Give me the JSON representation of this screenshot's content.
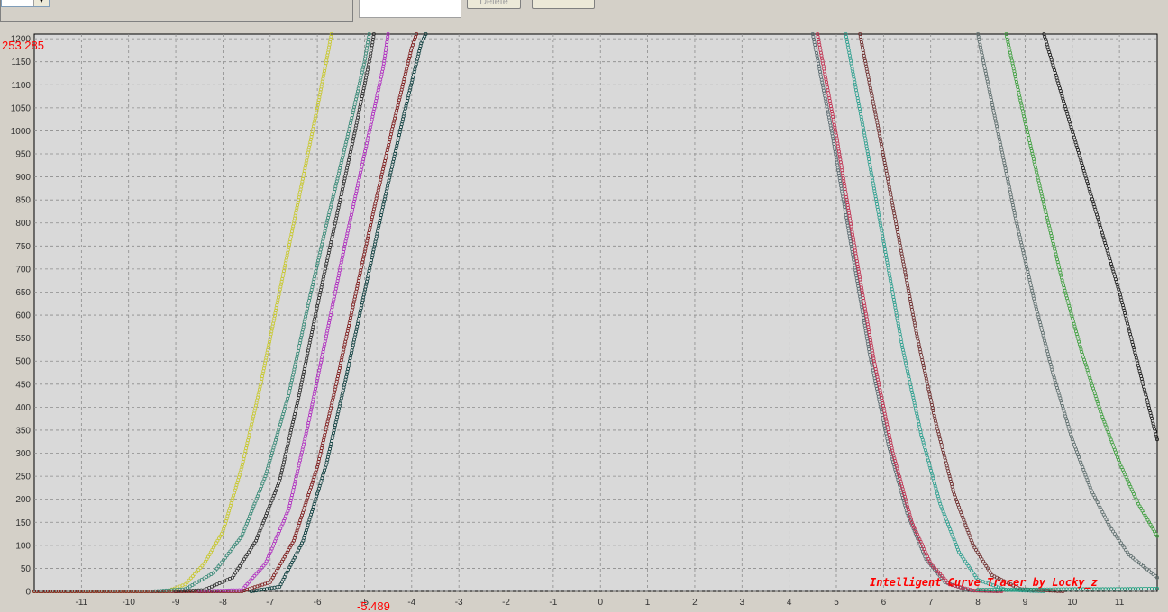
{
  "toolbar": {
    "delete_label": "Delete",
    "extra_label": ""
  },
  "plot": {
    "top_readout": "253.285",
    "bottom_readout": "-5.489",
    "watermark": "Intelligent Curve Tracer by Locky_z"
  },
  "colors": {
    "background": "#d4d0c8",
    "plot_bg": "#d9d9d9",
    "grid": "#8c8c8c",
    "readout": "#ff0000"
  },
  "chart_data": {
    "type": "scatter",
    "title": "",
    "xlabel": "",
    "ylabel": "",
    "xlim": [
      -12,
      11.8
    ],
    "ylim": [
      0,
      1210
    ],
    "x_ticks": [
      -11,
      -10,
      -9,
      -8,
      -7,
      -6,
      -5,
      -4,
      -3,
      -2,
      -1,
      0,
      1,
      2,
      3,
      4,
      5,
      6,
      7,
      8,
      9,
      10,
      11
    ],
    "y_ticks": [
      0,
      50,
      100,
      150,
      200,
      250,
      300,
      350,
      400,
      450,
      500,
      550,
      600,
      650,
      700,
      750,
      800,
      850,
      900,
      950,
      1000,
      1050,
      1100,
      1150,
      1200
    ],
    "grid": true,
    "series": [
      {
        "color": "#c8c830",
        "points": [
          [
            -12,
            0
          ],
          [
            -9.2,
            0
          ],
          [
            -8.8,
            15
          ],
          [
            -8.4,
            60
          ],
          [
            -8.0,
            130
          ],
          [
            -7.6,
            270
          ],
          [
            -7.2,
            450
          ],
          [
            -6.8,
            650
          ],
          [
            -6.4,
            850
          ],
          [
            -6.0,
            1050
          ],
          [
            -5.7,
            1210
          ]
        ]
      },
      {
        "color": "#3a8a78",
        "points": [
          [
            -9.5,
            0
          ],
          [
            -8.8,
            5
          ],
          [
            -8.2,
            40
          ],
          [
            -7.6,
            120
          ],
          [
            -7.1,
            250
          ],
          [
            -6.6,
            430
          ],
          [
            -6.2,
            620
          ],
          [
            -5.8,
            800
          ],
          [
            -5.4,
            970
          ],
          [
            -5.0,
            1150
          ],
          [
            -4.9,
            1210
          ]
        ]
      },
      {
        "color": "#303030",
        "points": [
          [
            -9.0,
            0
          ],
          [
            -8.4,
            3
          ],
          [
            -7.8,
            30
          ],
          [
            -7.3,
            110
          ],
          [
            -6.8,
            240
          ],
          [
            -6.4,
            420
          ],
          [
            -6.0,
            620
          ],
          [
            -5.6,
            810
          ],
          [
            -5.2,
            1000
          ],
          [
            -4.9,
            1150
          ],
          [
            -4.8,
            1210
          ]
        ]
      },
      {
        "color": "#b030c0",
        "points": [
          [
            -8.5,
            0
          ],
          [
            -7.6,
            3
          ],
          [
            -7.1,
            60
          ],
          [
            -6.6,
            180
          ],
          [
            -6.2,
            360
          ],
          [
            -5.8,
            560
          ],
          [
            -5.4,
            760
          ],
          [
            -5.0,
            950
          ],
          [
            -4.6,
            1140
          ],
          [
            -4.5,
            1210
          ]
        ]
      },
      {
        "color": "#802020",
        "points": [
          [
            -12,
            0
          ],
          [
            -7.6,
            0
          ],
          [
            -7.0,
            20
          ],
          [
            -6.5,
            110
          ],
          [
            -6.0,
            270
          ],
          [
            -5.6,
            450
          ],
          [
            -5.2,
            640
          ],
          [
            -4.8,
            830
          ],
          [
            -4.4,
            1010
          ],
          [
            -4.0,
            1180
          ],
          [
            -3.9,
            1210
          ]
        ]
      },
      {
        "color": "#104040",
        "points": [
          [
            -7.4,
            0
          ],
          [
            -6.8,
            10
          ],
          [
            -6.3,
            110
          ],
          [
            -5.8,
            280
          ],
          [
            -5.4,
            460
          ],
          [
            -5.0,
            650
          ],
          [
            -4.6,
            840
          ],
          [
            -4.2,
            1020
          ],
          [
            -3.8,
            1190
          ],
          [
            -3.7,
            1210
          ]
        ]
      },
      {
        "color": "#5a6a70",
        "points": [
          [
            4.5,
            1210
          ],
          [
            4.9,
            1000
          ],
          [
            5.3,
            760
          ],
          [
            5.7,
            520
          ],
          [
            6.1,
            320
          ],
          [
            6.5,
            170
          ],
          [
            6.9,
            70
          ],
          [
            7.3,
            20
          ],
          [
            7.8,
            2
          ],
          [
            8.4,
            0
          ]
        ]
      },
      {
        "color": "#c03050",
        "points": [
          [
            4.6,
            1210
          ],
          [
            5.0,
            990
          ],
          [
            5.4,
            740
          ],
          [
            5.8,
            500
          ],
          [
            6.2,
            300
          ],
          [
            6.6,
            150
          ],
          [
            7.0,
            60
          ],
          [
            7.4,
            15
          ],
          [
            7.9,
            2
          ],
          [
            8.5,
            0
          ]
        ]
      },
      {
        "color": "#30a090",
        "points": [
          [
            5.2,
            1210
          ],
          [
            5.6,
            990
          ],
          [
            6.0,
            760
          ],
          [
            6.4,
            530
          ],
          [
            6.8,
            340
          ],
          [
            7.2,
            190
          ],
          [
            7.6,
            85
          ],
          [
            8.0,
            25
          ],
          [
            8.6,
            3
          ],
          [
            9.4,
            0
          ]
        ]
      },
      {
        "color": "#703030",
        "points": [
          [
            5.5,
            1210
          ],
          [
            5.9,
            1000
          ],
          [
            6.3,
            780
          ],
          [
            6.7,
            560
          ],
          [
            7.1,
            370
          ],
          [
            7.5,
            210
          ],
          [
            7.9,
            100
          ],
          [
            8.3,
            35
          ],
          [
            8.9,
            5
          ],
          [
            9.8,
            0
          ]
        ]
      },
      {
        "color": "#607070",
        "points": [
          [
            8.0,
            1210
          ],
          [
            8.4,
            1010
          ],
          [
            8.8,
            810
          ],
          [
            9.2,
            630
          ],
          [
            9.6,
            470
          ],
          [
            10.0,
            330
          ],
          [
            10.4,
            220
          ],
          [
            10.8,
            140
          ],
          [
            11.2,
            80
          ],
          [
            11.8,
            30
          ]
        ]
      },
      {
        "color": "#40a040",
        "points": [
          [
            8.6,
            1210
          ],
          [
            9.0,
            1020
          ],
          [
            9.4,
            840
          ],
          [
            9.8,
            670
          ],
          [
            10.2,
            520
          ],
          [
            10.6,
            390
          ],
          [
            11.0,
            280
          ],
          [
            11.4,
            190
          ],
          [
            11.8,
            120
          ]
        ]
      },
      {
        "color": "#202020",
        "points": [
          [
            9.4,
            1210
          ],
          [
            9.8,
            1070
          ],
          [
            10.2,
            930
          ],
          [
            10.6,
            790
          ],
          [
            11.0,
            650
          ],
          [
            11.4,
            490
          ],
          [
            11.8,
            330
          ]
        ]
      },
      {
        "color": "#20a080",
        "points": [
          [
            8.0,
            4
          ],
          [
            9.0,
            4
          ],
          [
            10.0,
            5
          ],
          [
            11.0,
            5
          ],
          [
            11.8,
            6
          ]
        ]
      }
    ]
  }
}
